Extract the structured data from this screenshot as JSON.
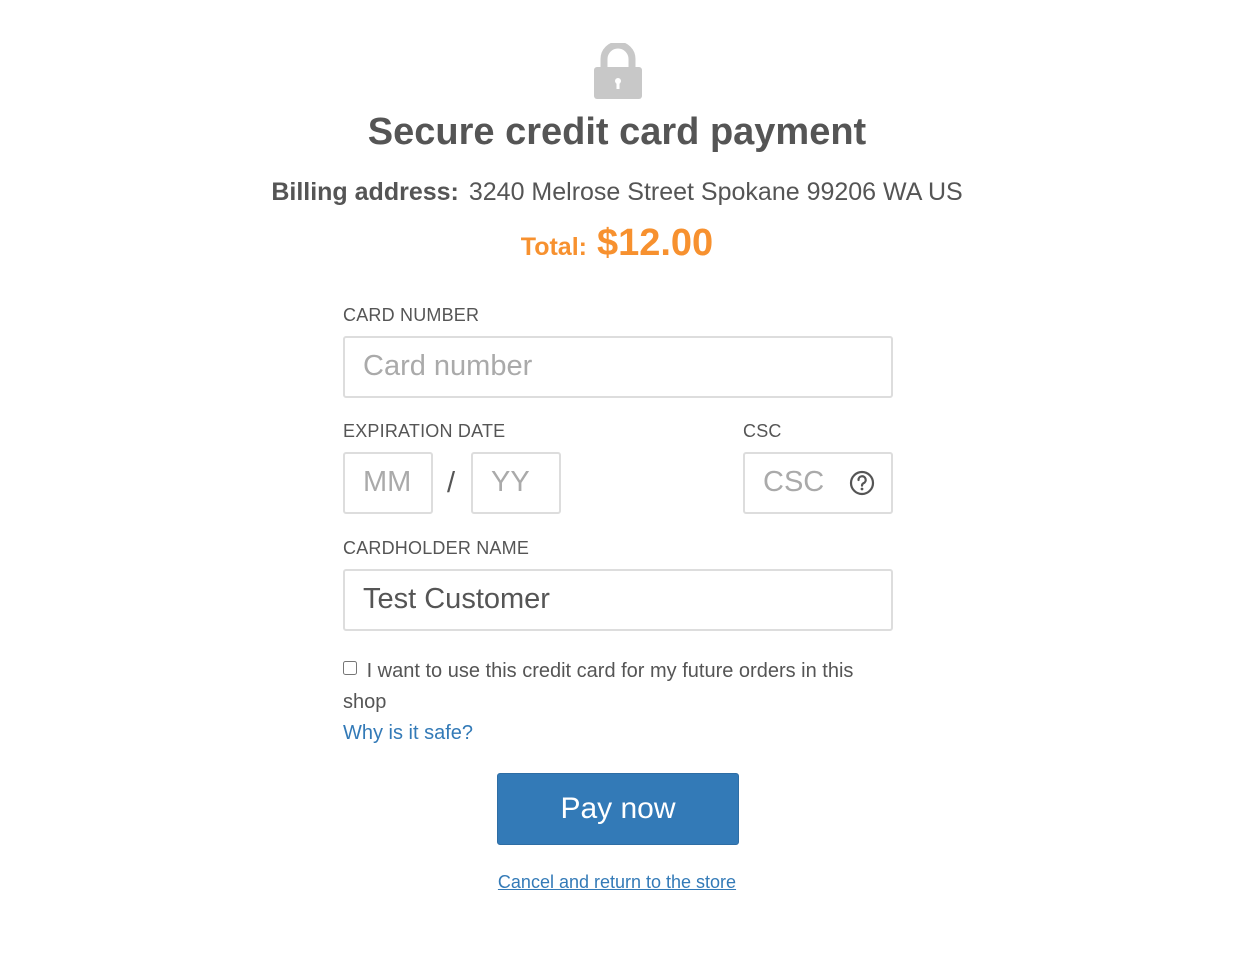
{
  "header": {
    "lock_icon": "lock-icon",
    "title": "Secure credit card payment"
  },
  "billing": {
    "label": "Billing address:",
    "address": "3240 Melrose Street Spokane 99206 WA US"
  },
  "total": {
    "label": "Total:",
    "amount": "$12.00",
    "color": "#f7912f"
  },
  "form": {
    "card_number": {
      "label": "CARD NUMBER",
      "placeholder": "Card number",
      "value": ""
    },
    "expiration": {
      "label": "EXPIRATION DATE",
      "month_placeholder": "MM",
      "separator": "/",
      "year_placeholder": "YY"
    },
    "csc": {
      "label": "CSC",
      "placeholder": "CSC",
      "help_icon": "question-circle-icon"
    },
    "cardholder": {
      "label": "CARDHOLDER NAME",
      "value": "Test Customer"
    },
    "remember": {
      "checked": false,
      "text": "I want to use this credit card for my future orders in this shop"
    },
    "why_safe_link": "Why is it safe?"
  },
  "actions": {
    "pay_label": "Pay now",
    "pay_color": "#337ab7",
    "cancel_label": "Cancel and return to the store"
  }
}
